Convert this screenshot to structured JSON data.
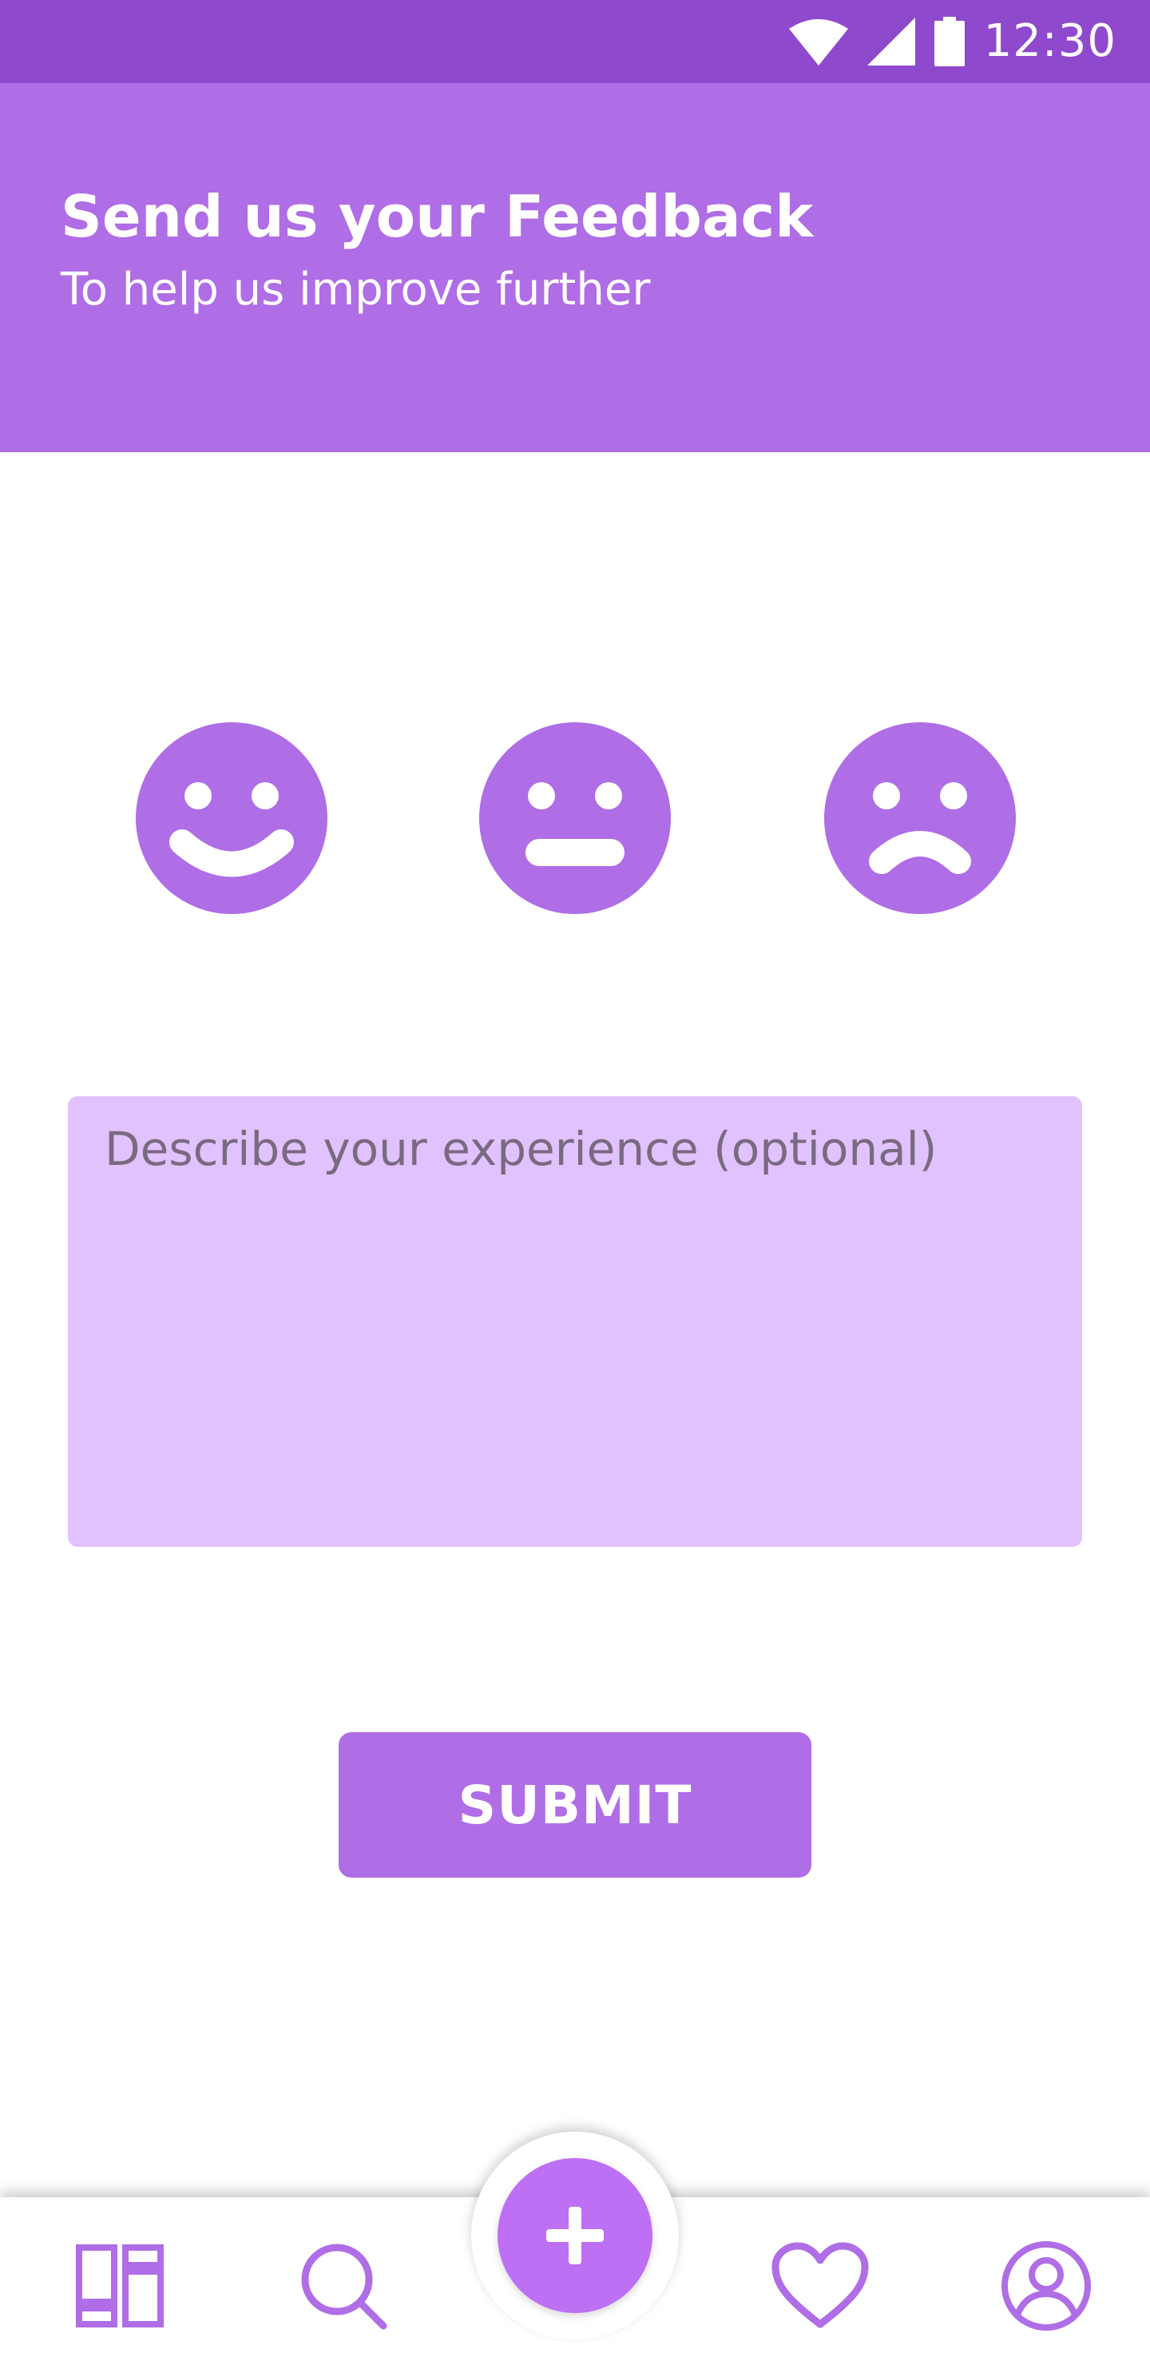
{
  "status_bar": {
    "time": "12:30",
    "icons": [
      "wifi-icon",
      "cellular-signal-icon",
      "battery-icon"
    ]
  },
  "header": {
    "title": "Send us your Feedback",
    "subtitle": "To help us improve further"
  },
  "ratings": [
    {
      "name": "happy-face-icon"
    },
    {
      "name": "neutral-face-icon"
    },
    {
      "name": "sad-face-icon"
    }
  ],
  "feedback": {
    "value": "",
    "placeholder": "Describe your experience (optional)"
  },
  "submit": {
    "label": "SUBMIT"
  },
  "bottom_nav": {
    "items": [
      "dashboard-icon",
      "search-icon",
      "add-icon",
      "heart-icon",
      "profile-icon"
    ]
  },
  "colors": {
    "status_bar": "#8e49cd",
    "accent": "#af6de6",
    "input_background": "#e2c2fe",
    "fab": "#bd70f4",
    "background": "#ffffff"
  }
}
